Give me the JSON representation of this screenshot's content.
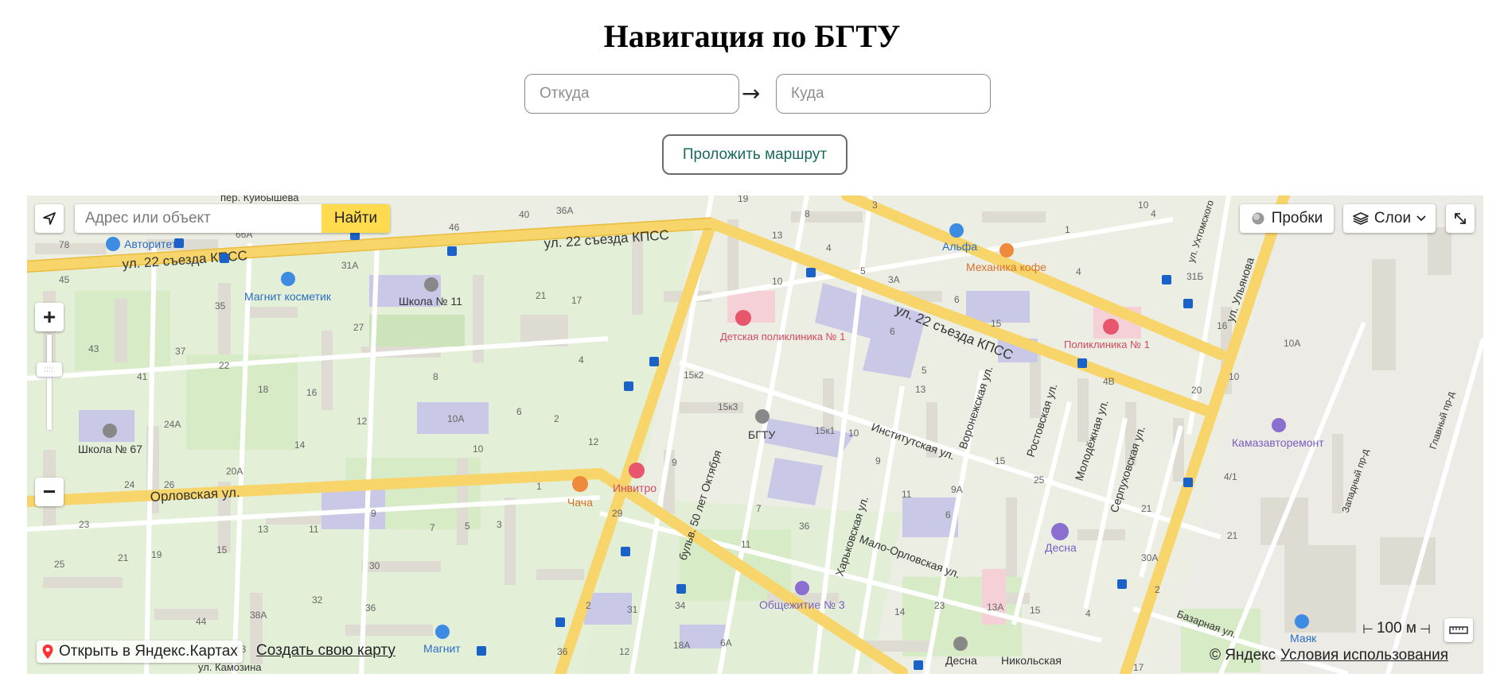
{
  "page": {
    "title": "Навигация по БГТУ",
    "from_placeholder": "Откуда",
    "to_placeholder": "Куда",
    "arrow": "→",
    "route_button": "Проложить маршрут"
  },
  "map": {
    "search_placeholder": "Адрес или объект",
    "find_button": "Найти",
    "traffic_button": "Пробки",
    "layers_button": "Слои",
    "zoom_in": "+",
    "zoom_out": "−",
    "scale_label": "100 м",
    "open_in_yandex": "Открыть в Яндекс.Картах",
    "create_map": "Создать свою карту",
    "copyright": "© Яндекс",
    "terms": "Условия использования",
    "colors": {
      "road_major": "#f7d56a",
      "road_minor": "#ffffff",
      "park": "#d5ebc4",
      "building": "#d8d5cc",
      "institution": "#c8c8e8",
      "accent": "#ffdb4d"
    },
    "streets": [
      "ул. 22 съезда КПСС",
      "ул. 22 съезда КПСС",
      "ул. 22 съезда КПСС",
      "Орловская ул.",
      "бульв. 50 лет Октября",
      "Институтская ул.",
      "Харьковская ул.",
      "Мало-Орловская ул.",
      "Воронежская ул.",
      "Ростовская ул.",
      "Молодёжная ул.",
      "Серпуховская ул.",
      "ул. Ульянова",
      "ул. Ухтомского",
      "Западный пр-д",
      "Главный пр-д",
      "Базарная ул.",
      "пер. Куйбышева",
      "ул. Камозина",
      "Никольская"
    ],
    "pois": [
      {
        "name": "Авторитет",
        "color": "#3d8be3"
      },
      {
        "name": "Магнит косметик",
        "color": "#3d8be3"
      },
      {
        "name": "Школа № 11",
        "color": "#777777"
      },
      {
        "name": "Школа № 67",
        "color": "#777777"
      },
      {
        "name": "Детская поликлиника № 1",
        "color": "#e8566d"
      },
      {
        "name": "Поликлиника № 1",
        "color": "#e8566d"
      },
      {
        "name": "БГТУ",
        "color": "#777777"
      },
      {
        "name": "Инвитро",
        "color": "#e8566d"
      },
      {
        "name": "Чача",
        "color": "#ef8a3c"
      },
      {
        "name": "Альфа",
        "color": "#3d8be3"
      },
      {
        "name": "Механика кофе",
        "color": "#ef8a3c"
      },
      {
        "name": "Камазавторемонт",
        "color": "#8a6ed0"
      },
      {
        "name": "Десна",
        "color": "#8a6ed0"
      },
      {
        "name": "Общежитие № 3",
        "color": "#8a6ed0"
      },
      {
        "name": "Магнит",
        "color": "#3d8be3"
      },
      {
        "name": "Маяк",
        "color": "#3d8be3"
      },
      {
        "name": "Десна",
        "color": "#777777"
      }
    ],
    "house_numbers": [
      "19",
      "8",
      "3",
      "40",
      "36А",
      "46",
      "66А",
      "78",
      "31А",
      "45",
      "35",
      "43",
      "41",
      "37",
      "27",
      "21",
      "17",
      "22",
      "18",
      "16",
      "12",
      "24А",
      "4",
      "8",
      "6",
      "2",
      "10А",
      "10",
      "12",
      "14",
      "20А",
      "24",
      "26",
      "1",
      "23",
      "13",
      "11",
      "9",
      "7",
      "5",
      "3",
      "29",
      "25",
      "21",
      "19",
      "15",
      "30",
      "32",
      "36",
      "38А",
      "44",
      "13",
      "15к1",
      "15к2",
      "15к3",
      "9",
      "7",
      "36",
      "11",
      "34",
      "31",
      "2",
      "6А",
      "18А",
      "36",
      "12",
      "13",
      "10",
      "5",
      "4",
      "3А",
      "6",
      "15",
      "6",
      "5",
      "13",
      "10",
      "9",
      "11",
      "9А",
      "6",
      "15",
      "25",
      "21",
      "30А",
      "14",
      "23",
      "13А",
      "15",
      "4",
      "2",
      "4В",
      "17",
      "10",
      "1",
      "4",
      "4",
      "31Б",
      "16",
      "20",
      "10",
      "10А",
      "4/1",
      "21"
    ]
  }
}
